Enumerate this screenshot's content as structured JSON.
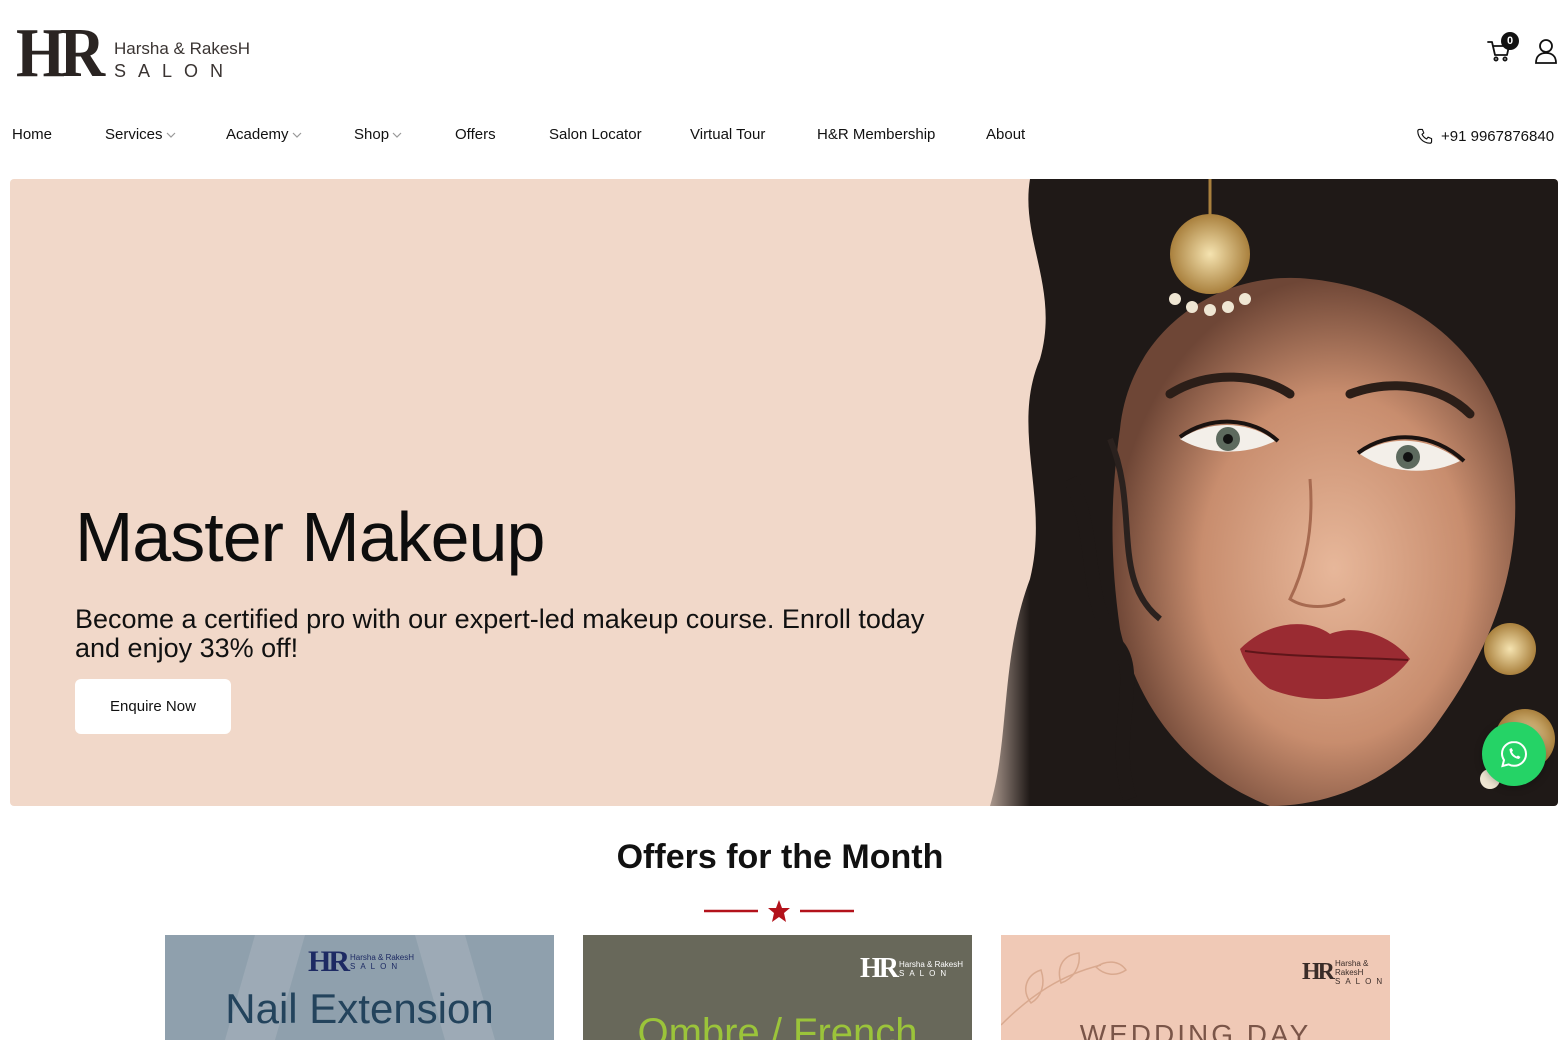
{
  "brand": {
    "mark": "HR",
    "line1": "Harsha & RakesH",
    "line2": "SALON"
  },
  "header": {
    "cart_count": "0",
    "cart_icon": "cart-icon",
    "user_icon": "user-icon"
  },
  "nav": {
    "items": [
      {
        "label": "Home",
        "dropdown": false
      },
      {
        "label": "Services",
        "dropdown": true
      },
      {
        "label": "Academy",
        "dropdown": true
      },
      {
        "label": "Shop",
        "dropdown": true
      },
      {
        "label": "Offers",
        "dropdown": false
      },
      {
        "label": "Salon Locator",
        "dropdown": false
      },
      {
        "label": "Virtual Tour",
        "dropdown": false
      },
      {
        "label": "H&R Membership",
        "dropdown": false
      },
      {
        "label": "About",
        "dropdown": false
      }
    ],
    "phone": "+91 9967876840"
  },
  "hero": {
    "title": "Master Makeup",
    "subtitle": "Become a certified pro with our expert-led makeup course. Enroll today and enjoy 33% off!",
    "button": "Enquire Now",
    "background": "#f1d8c9"
  },
  "offers": {
    "title": "Offers for the Month",
    "accent": "#b3121b",
    "cards": [
      {
        "logo_line1": "Harsha & RakesH",
        "logo_line2": "SALON",
        "title": "Nail Extension",
        "bg": "#8fa0ad"
      },
      {
        "logo_line1": "Harsha & RakesH",
        "logo_line2": "SALON",
        "title": "Ombre / French",
        "bg": "#68685a"
      },
      {
        "logo_line1": "Harsha & RakesH",
        "logo_line2": "SALON",
        "title": "WEDDING DAY",
        "bg": "#f0c9b6"
      }
    ]
  },
  "whatsapp": {
    "icon": "whatsapp-icon",
    "color": "#25d366"
  }
}
